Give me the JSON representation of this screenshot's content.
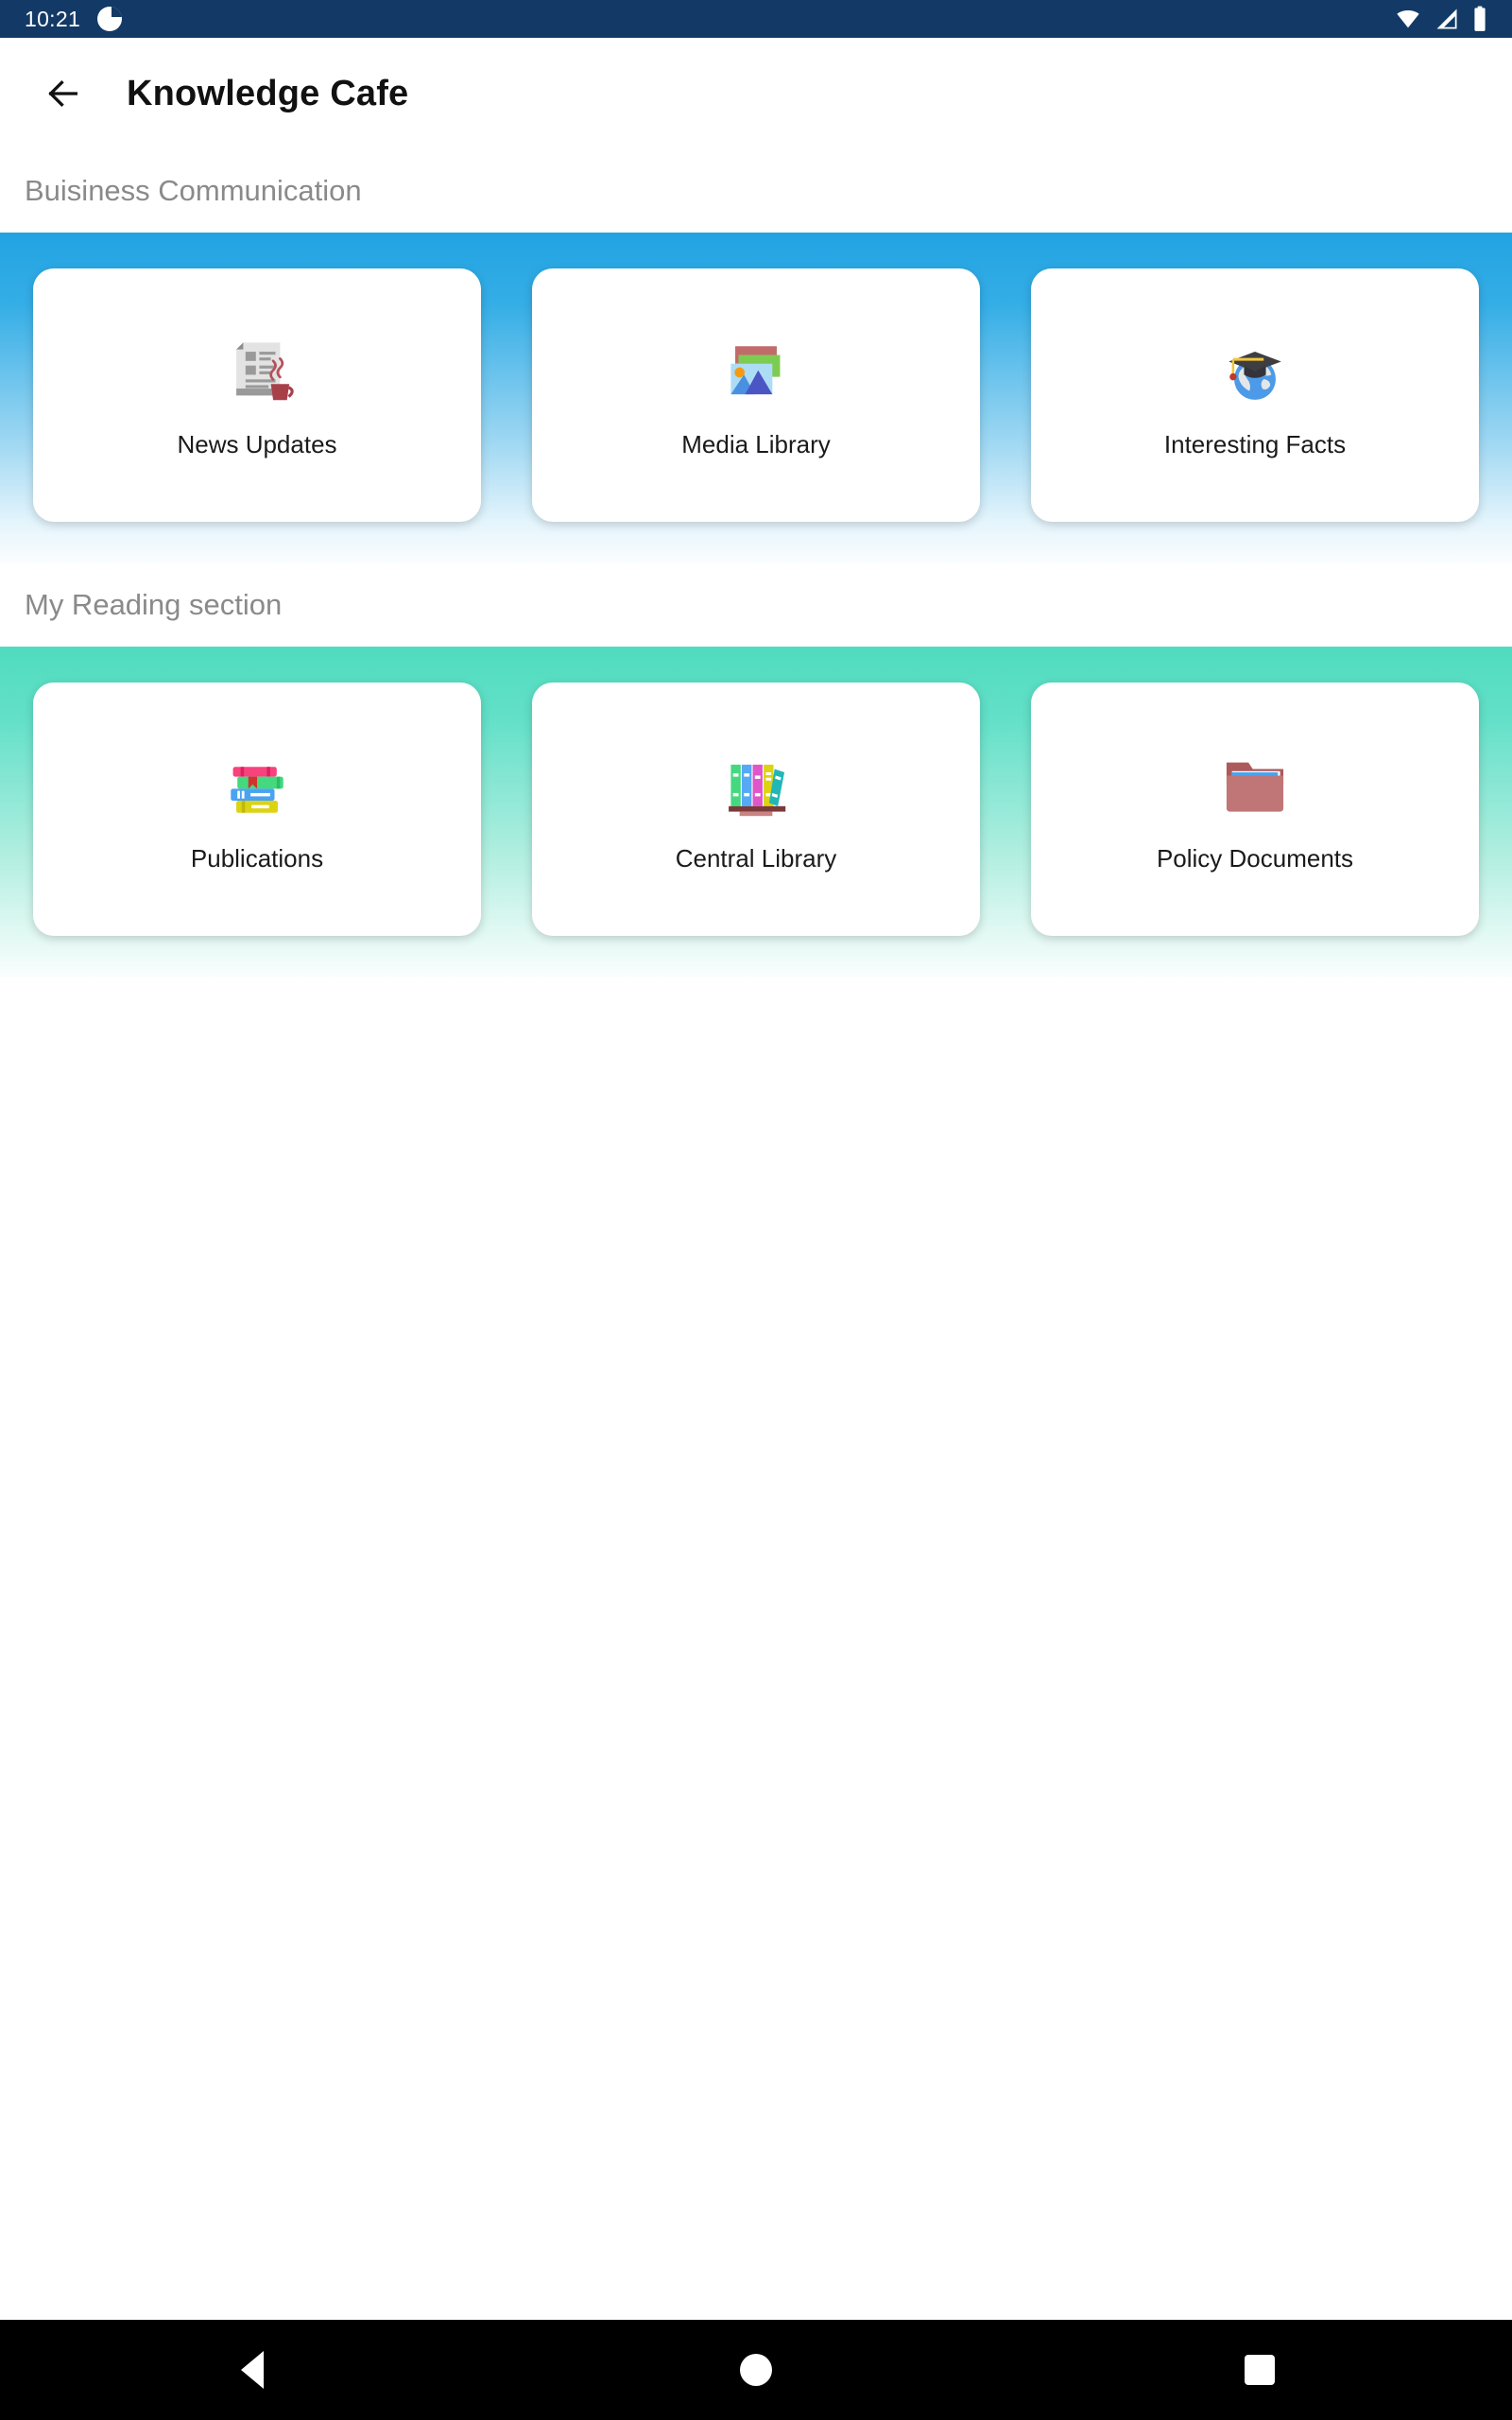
{
  "status_bar": {
    "time": "10:21",
    "notification_icon": "circle-notification-icon",
    "wifi_icon": "wifi-icon",
    "signal_icon": "cell-signal-icon",
    "battery_icon": "battery-full-icon",
    "background_color": "#133A66"
  },
  "app_bar": {
    "back_icon": "arrow-left-icon",
    "title": "Knowledge Cafe"
  },
  "sections": [
    {
      "heading": "Buisiness Communication",
      "band_color": "#22A3E2",
      "cards": [
        {
          "label": "News Updates",
          "icon": "newspaper-coffee-icon"
        },
        {
          "label": "Media Library",
          "icon": "photo-stack-icon"
        },
        {
          "label": "Interesting Facts",
          "icon": "globe-graduation-cap-icon"
        }
      ]
    },
    {
      "heading": "My Reading section",
      "band_color": "#4FDCBE",
      "cards": [
        {
          "label": "Publications",
          "icon": "book-stack-icon"
        },
        {
          "label": "Central Library",
          "icon": "bookshelf-icon"
        },
        {
          "label": "Policy Documents",
          "icon": "folder-documents-icon"
        }
      ]
    }
  ],
  "nav_bar": {
    "back_label": "back-triangle",
    "home_label": "home-circle",
    "recents_label": "recents-square"
  }
}
